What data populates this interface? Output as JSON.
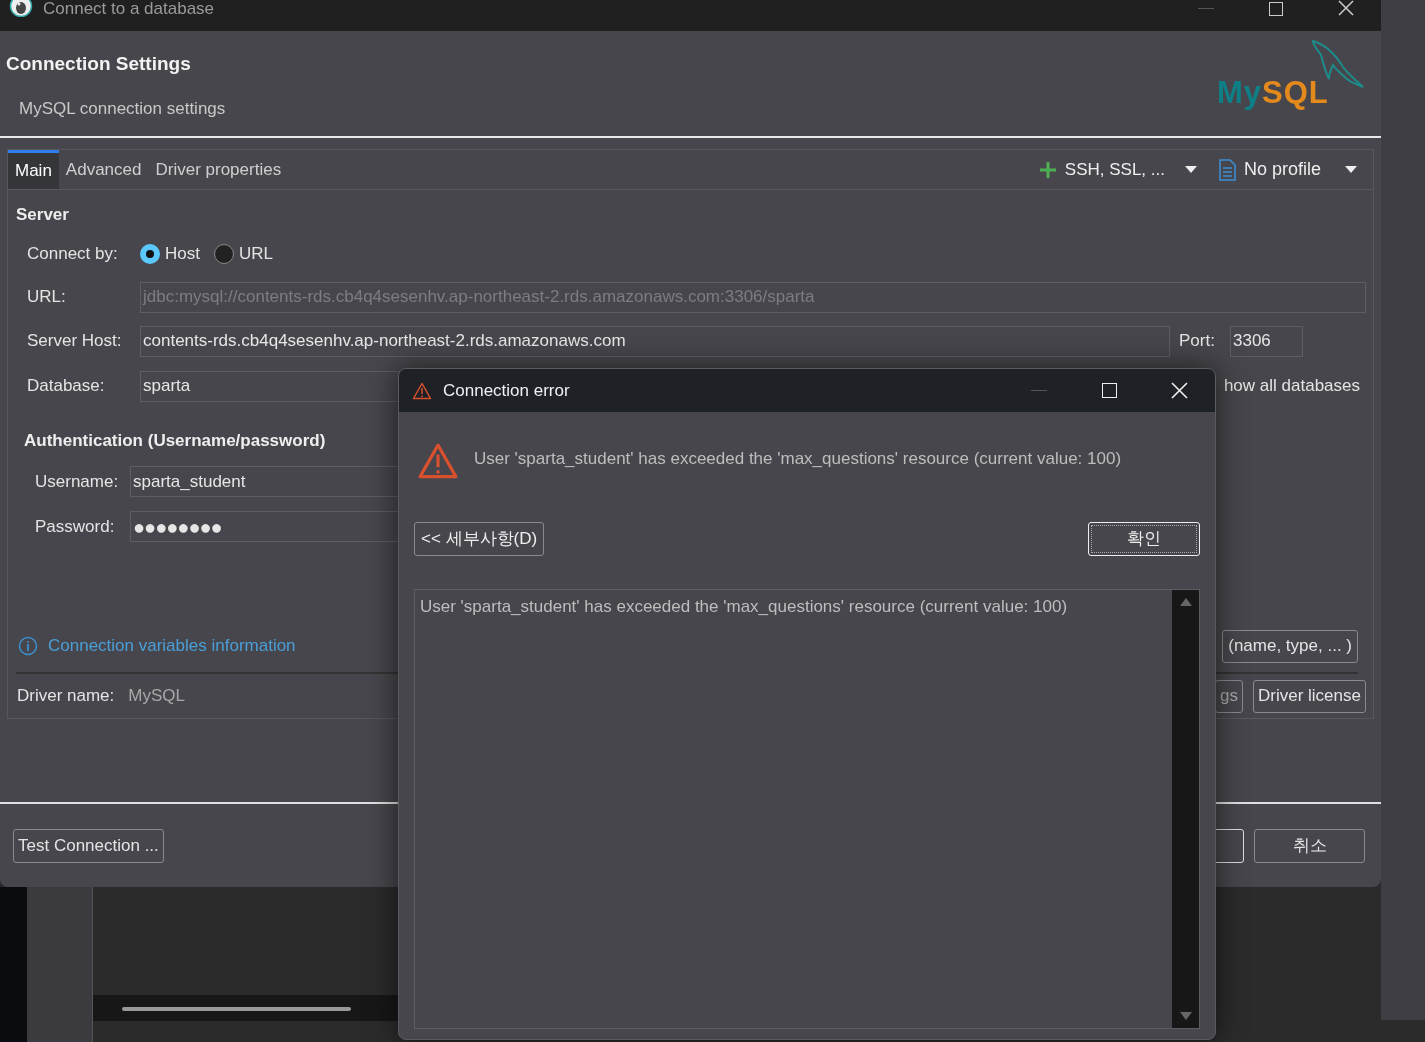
{
  "window": {
    "title": "Connect to a database"
  },
  "header": {
    "title": "Connection Settings",
    "subtitle": "MySQL connection settings",
    "logo": {
      "part_1": "My",
      "part_2": "SQL"
    }
  },
  "tabs": [
    {
      "label": "Main",
      "selected": true
    },
    {
      "label": "Advanced",
      "selected": false
    },
    {
      "label": "Driver properties",
      "selected": false
    }
  ],
  "toolbar": {
    "network": "SSH, SSL, ...",
    "profile": "No profile"
  },
  "server": {
    "heading": "Server",
    "connect_by_label": "Connect by:",
    "connect_by": [
      {
        "label": "Host",
        "selected": true
      },
      {
        "label": "URL",
        "selected": false
      }
    ],
    "url_label": "URL:",
    "url_value": "jdbc:mysql://contents-rds.cb4q4sesenhv.ap-northeast-2.rds.amazonaws.com:3306/sparta",
    "host_label": "Server Host:",
    "host_value": "contents-rds.cb4q4sesenhv.ap-northeast-2.rds.amazonaws.com",
    "port_label": "Port:",
    "port_value": "3306",
    "database_label": "Database:",
    "database_value": "sparta",
    "show_all_fragment": "how all databases"
  },
  "auth": {
    "heading": "Authentication (Username/password)",
    "username_label": "Username:",
    "username_value": "sparta_student",
    "password_label": "Password:",
    "password_mask": "●●●●●●●●"
  },
  "info_link": "Connection variables information",
  "variables_button_fragment": "(name, type, ... )",
  "driver": {
    "label": "Driver name:",
    "value": "MySQL",
    "settings_fragment": "gs",
    "license_button": "Driver license"
  },
  "footer": {
    "test_button": "Test Connection ...",
    "cancel_button": "취소"
  },
  "error_dialog": {
    "title": "Connection error",
    "message": "User 'sparta_student' has exceeded the 'max_questions' resource (current value: 100)",
    "details_button": "<< 세부사항(D)",
    "ok_button": "확인",
    "details_text": "User 'sparta_student' has exceeded the 'max_questions' resource (current value: 100)"
  }
}
